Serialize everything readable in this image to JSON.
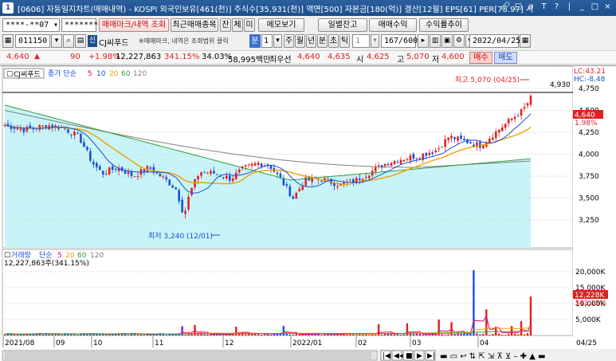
{
  "window": {
    "number": "1",
    "title": "[0606] 자동일지차트(매매내역) - KOSPI 외국인보유[461(천)] 주식수[35,931(천)] 액면[500] 자본금[180(억)] 결산[12월] EPS[61] PER[75.97] 시",
    "icons": [
      "🔗",
      "□",
      "ʙ",
      "T",
      "?",
      "|",
      "_",
      "□",
      "×"
    ]
  },
  "toolbar1": {
    "account": "****-**07",
    "password": "********",
    "btn_trade_mark": "매매마크/내역 조회",
    "btn_recent": "최근매매종목",
    "btn_jan": "잔",
    "btn_che": "체",
    "btn_mi": "미",
    "btn_memo": "메모보기",
    "btn_daily_balance": "일별잔고",
    "btn_trade_profit": "매매수익",
    "btn_return_trend": "수익률추이"
  },
  "toolbar2": {
    "code": "011150",
    "new_badge": "신",
    "stock_name": "CJ씨푸드",
    "notice": "※매매마크, 내역은 조회범위 클릭",
    "period_min": "분",
    "period_value": "1",
    "periods": [
      "주",
      "월",
      "년",
      "분",
      "초",
      "틱"
    ],
    "tick_value": "1",
    "count": "167/600",
    "date": "2022/04/25"
  },
  "info": {
    "price": "4,640",
    "arrow": "▲",
    "change": "90",
    "change_plus": "+",
    "change_pct": "1.98%",
    "volume": "12,227,863",
    "vol_ratio": "341.15%",
    "turnover": "34.03%",
    "amount": "58,995백만",
    "prio_label": "최우선",
    "ask": "4,640",
    "bid": "4,635",
    "open_label": "시",
    "open": "4,625",
    "high_label": "고",
    "high": "5,070",
    "low_label": "저",
    "low": "4,600",
    "buy_btn": "매수",
    "sell_btn": "매도"
  },
  "chart": {
    "legend_name": "CJ씨푸드",
    "legend_ma_label": "종가 단순",
    "legend_ma": [
      "5",
      "10",
      "20",
      "60",
      "120"
    ],
    "lc": "LC:43.21",
    "hc": "HC:-8.48",
    "high_note": "최고 5,070 (04/25)",
    "low_note": "최저 3,240 (12/01)",
    "cur_price_tag": "4,640",
    "cur_pct_tag": "1.98%",
    "hline_value": "4,930",
    "price_ticks": [
      "4,750",
      "4,500",
      "4,250",
      "4,000",
      "3,750",
      "3,500",
      "3,250"
    ],
    "vol_legend_name": "거래량",
    "vol_legend_ma_label": "단순",
    "vol_legend_ma": [
      "5",
      "20",
      "60",
      "120"
    ],
    "vol_value": "12,227,863주(341.15%)",
    "vol_ticks": [
      "20,000K",
      "15,000K",
      "10,000K",
      "5,000K"
    ],
    "vol_cur_tag": "12,228K",
    "vol_pct_tag": "341.15%",
    "x_labels": [
      "2021/08",
      "09",
      "10",
      "11",
      "12",
      "2022/01",
      "02",
      "03",
      "04"
    ],
    "x_right_label": "04/25",
    "colors": {
      "up": "#e02020",
      "down": "#1a4fd6",
      "cloud": "#c8f4f7",
      "ma5": "#e6007e",
      "ma10": "#1a4fd6",
      "ma20": "#f0a000",
      "ma60": "#2e9c3a",
      "ma120": "#808080"
    }
  }
}
